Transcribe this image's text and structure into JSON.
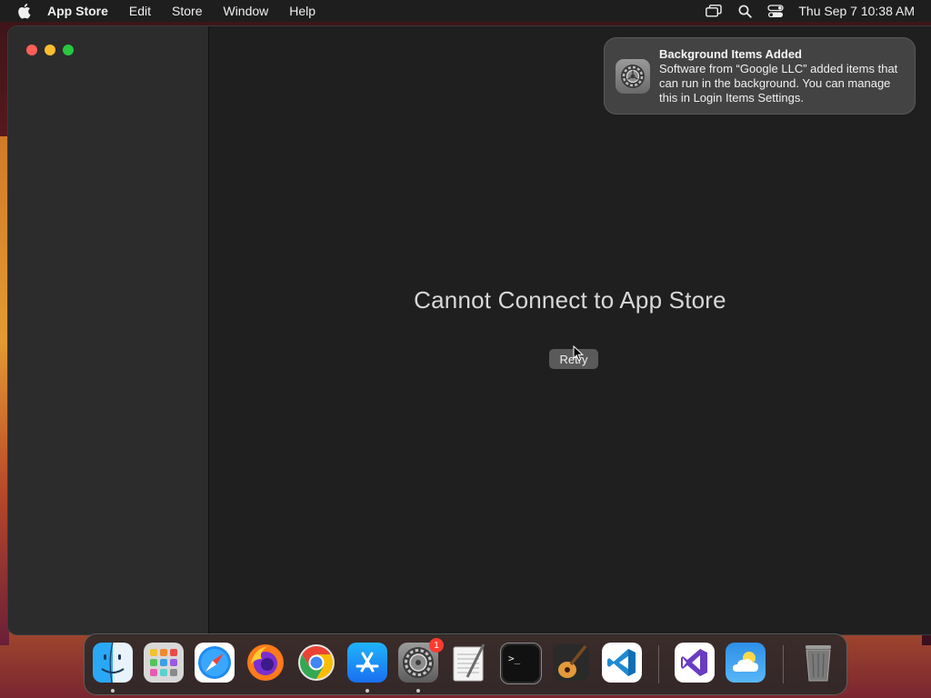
{
  "menubar": {
    "app_name": "App Store",
    "items": [
      "Edit",
      "Store",
      "Window",
      "Help"
    ],
    "clock": "Thu Sep 7  10:38 AM",
    "icons": [
      "screen-mirroring-icon",
      "spotlight-search-icon",
      "control-center-icon"
    ]
  },
  "window": {
    "error_message": "Cannot Connect to App Store",
    "retry_label": "Retry"
  },
  "notification": {
    "title": "Background Items Added",
    "body": "Software from “Google LLC” added items that can run in the background. You can manage this in Login Items Settings.",
    "icon": "system-settings-icon"
  },
  "dock": {
    "apps": [
      {
        "name": "Finder",
        "icon": "finder-icon",
        "running": true
      },
      {
        "name": "Launchpad",
        "icon": "launchpad-icon",
        "running": false
      },
      {
        "name": "Safari",
        "icon": "safari-icon",
        "running": false
      },
      {
        "name": "Firefox",
        "icon": "firefox-icon",
        "running": false
      },
      {
        "name": "Google Chrome",
        "icon": "chrome-icon",
        "running": false
      },
      {
        "name": "App Store",
        "icon": "app-store-icon",
        "running": true
      },
      {
        "name": "System Settings",
        "icon": "system-settings-icon",
        "running": true,
        "badge": "1"
      },
      {
        "name": "TextEdit",
        "icon": "textedit-icon",
        "running": false
      },
      {
        "name": "Terminal",
        "icon": "terminal-icon",
        "running": false
      },
      {
        "name": "GarageBand",
        "icon": "garageband-icon",
        "running": false
      },
      {
        "name": "Visual Studio Code",
        "icon": "vscode-icon",
        "running": false
      },
      {
        "name": "Visual Studio",
        "icon": "visual-studio-icon",
        "running": false
      },
      {
        "name": "Weather",
        "icon": "weather-icon",
        "running": false
      },
      {
        "name": "Trash",
        "icon": "trash-icon",
        "running": false
      }
    ]
  },
  "colors": {
    "close": "#fe5f57",
    "minimize": "#febc2e",
    "zoom": "#28c840",
    "badge": "#ff3b30"
  }
}
